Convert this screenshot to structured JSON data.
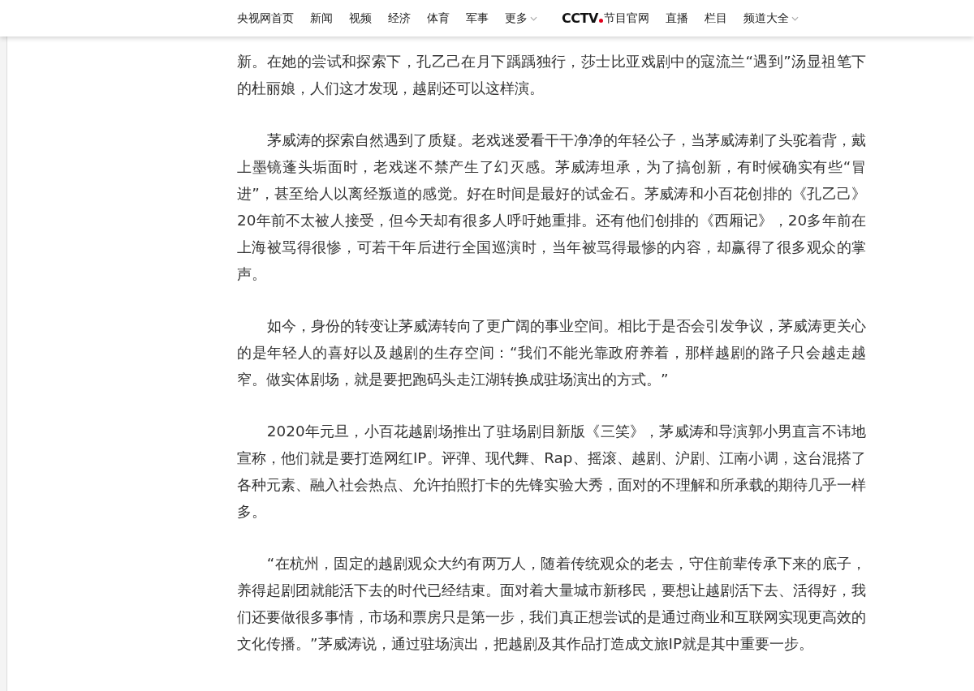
{
  "nav": {
    "items": [
      {
        "label": "央视网首页",
        "kind": "link"
      },
      {
        "label": "新闻",
        "kind": "link"
      },
      {
        "label": "视频",
        "kind": "link"
      },
      {
        "label": "经济",
        "kind": "link"
      },
      {
        "label": "体育",
        "kind": "link"
      },
      {
        "label": "军事",
        "kind": "link"
      },
      {
        "label": "更多",
        "kind": "dropdown"
      },
      {
        "label": "CCTV",
        "sub": "节目官网",
        "kind": "logo"
      },
      {
        "label": "直播",
        "kind": "link"
      },
      {
        "label": "栏目",
        "kind": "link"
      },
      {
        "label": "频道大全",
        "kind": "dropdown"
      }
    ]
  },
  "article": {
    "paragraphs": [
      {
        "text": "新。在她的尝试和探索下，孔乙己在月下踽踽独行，莎士比亚戏剧中的寇流兰“遇到”汤显祖笔下的杜丽娘，人们这才发现，越剧还可以这样演。",
        "indent": false
      },
      {
        "text": "茅威涛的探索自然遇到了质疑。老戏迷爱看干干净净的年轻公子，当茅威涛剃了头驼着背，戴上墨镜蓬头垢面时，老戏迷不禁产生了幻灭感。茅威涛坦承，为了搞创新，有时候确实有些“冒进”，甚至给人以离经叛道的感觉。好在时间是最好的试金石。茅威涛和小百花创排的《孔乙己》20年前不太被人接受，但今天却有很多人呼吁她重排。还有他们创排的《西厢记》，20多年前在上海被骂得很惨，可若干年后进行全国巡演时，当年被骂得最惨的内容，却赢得了很多观众的掌声。",
        "indent": true
      },
      {
        "text": "如今，身份的转变让茅威涛转向了更广阔的事业空间。相比于是否会引发争议，茅威涛更关心的是年轻人的喜好以及越剧的生存空间：“我们不能光靠政府养着，那样越剧的路子只会越走越窄。做实体剧场，就是要把跑码头走江湖转换成驻场演出的方式。”",
        "indent": true
      },
      {
        "text": "2020年元旦，小百花越剧场推出了驻场剧目新版《三笑》，茅威涛和导演郭小男直言不讳地宣称，他们就是要打造网红IP。评弹、现代舞、Rap、摇滚、越剧、沪剧、江南小调，这台混搭了各种元素、融入社会热点、允许拍照打卡的先锋实验大秀，面对的不理解和所承载的期待几乎一样多。",
        "indent": true
      },
      {
        "text": "“在杭州，固定的越剧观众大约有两万人，随着传统观众的老去，守住前辈传承下来的底子，养得起剧团就能活下去的时代已经结束。面对着大量城市新移民，要想让越剧活下去、活得好，我们还要做很多事情，市场和票房只是第一步，我们真正想尝试的是通过商业和互联网实现更高效的文化传播。”茅威涛说，通过驻场演出，把越剧及其作品打造成文旅IP就是其中重要一步。",
        "indent": true
      }
    ]
  }
}
